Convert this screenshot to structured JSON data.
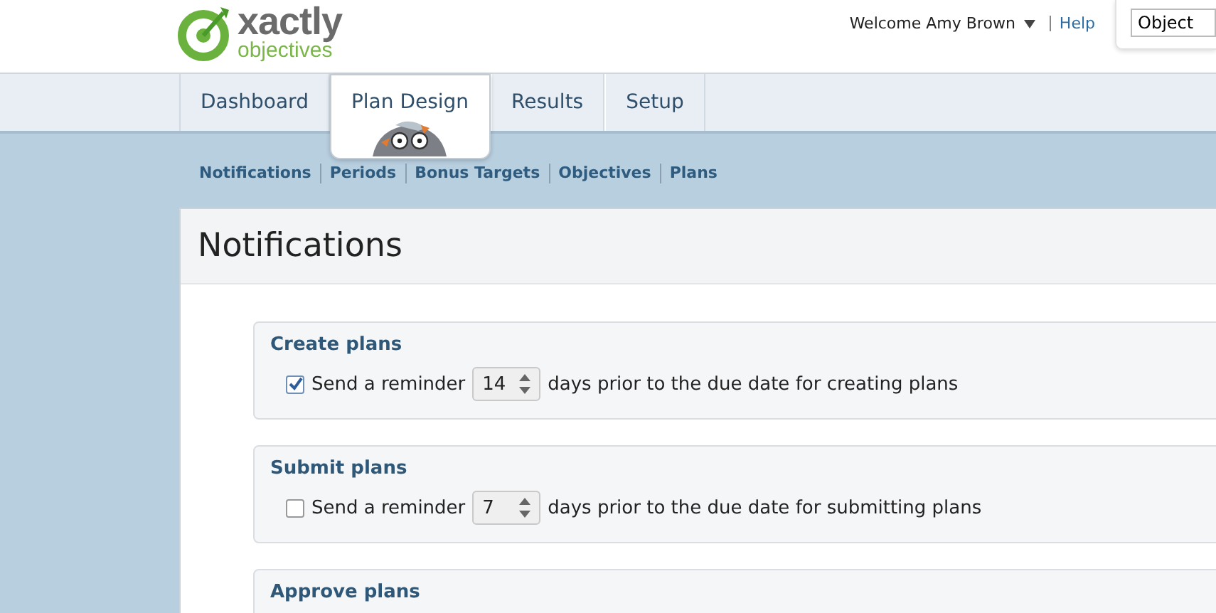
{
  "logo": {
    "name": "xactly",
    "product": "objectives"
  },
  "header": {
    "welcome": "Welcome Amy Brown",
    "help": "Help",
    "search_value": "Object"
  },
  "tabs": [
    {
      "label": "Dashboard",
      "selected": false
    },
    {
      "label": "Plan Design",
      "selected": true
    },
    {
      "label": "Results",
      "selected": false
    },
    {
      "label": "Setup",
      "selected": false
    }
  ],
  "subnav": [
    "Notifications",
    "Periods",
    "Bonus Targets",
    "Objectives",
    "Plans"
  ],
  "page_title": "Notifications",
  "sections": [
    {
      "title": "Create plans",
      "reminder": {
        "checked": true,
        "label": "Send a reminder",
        "value": "14",
        "suffix": "days prior to the due date for creating plans"
      }
    },
    {
      "title": "Submit plans",
      "reminder": {
        "checked": false,
        "label": "Send a reminder",
        "value": "7",
        "suffix": "days prior to the due date for submitting plans"
      }
    },
    {
      "title": "Approve plans"
    }
  ]
}
